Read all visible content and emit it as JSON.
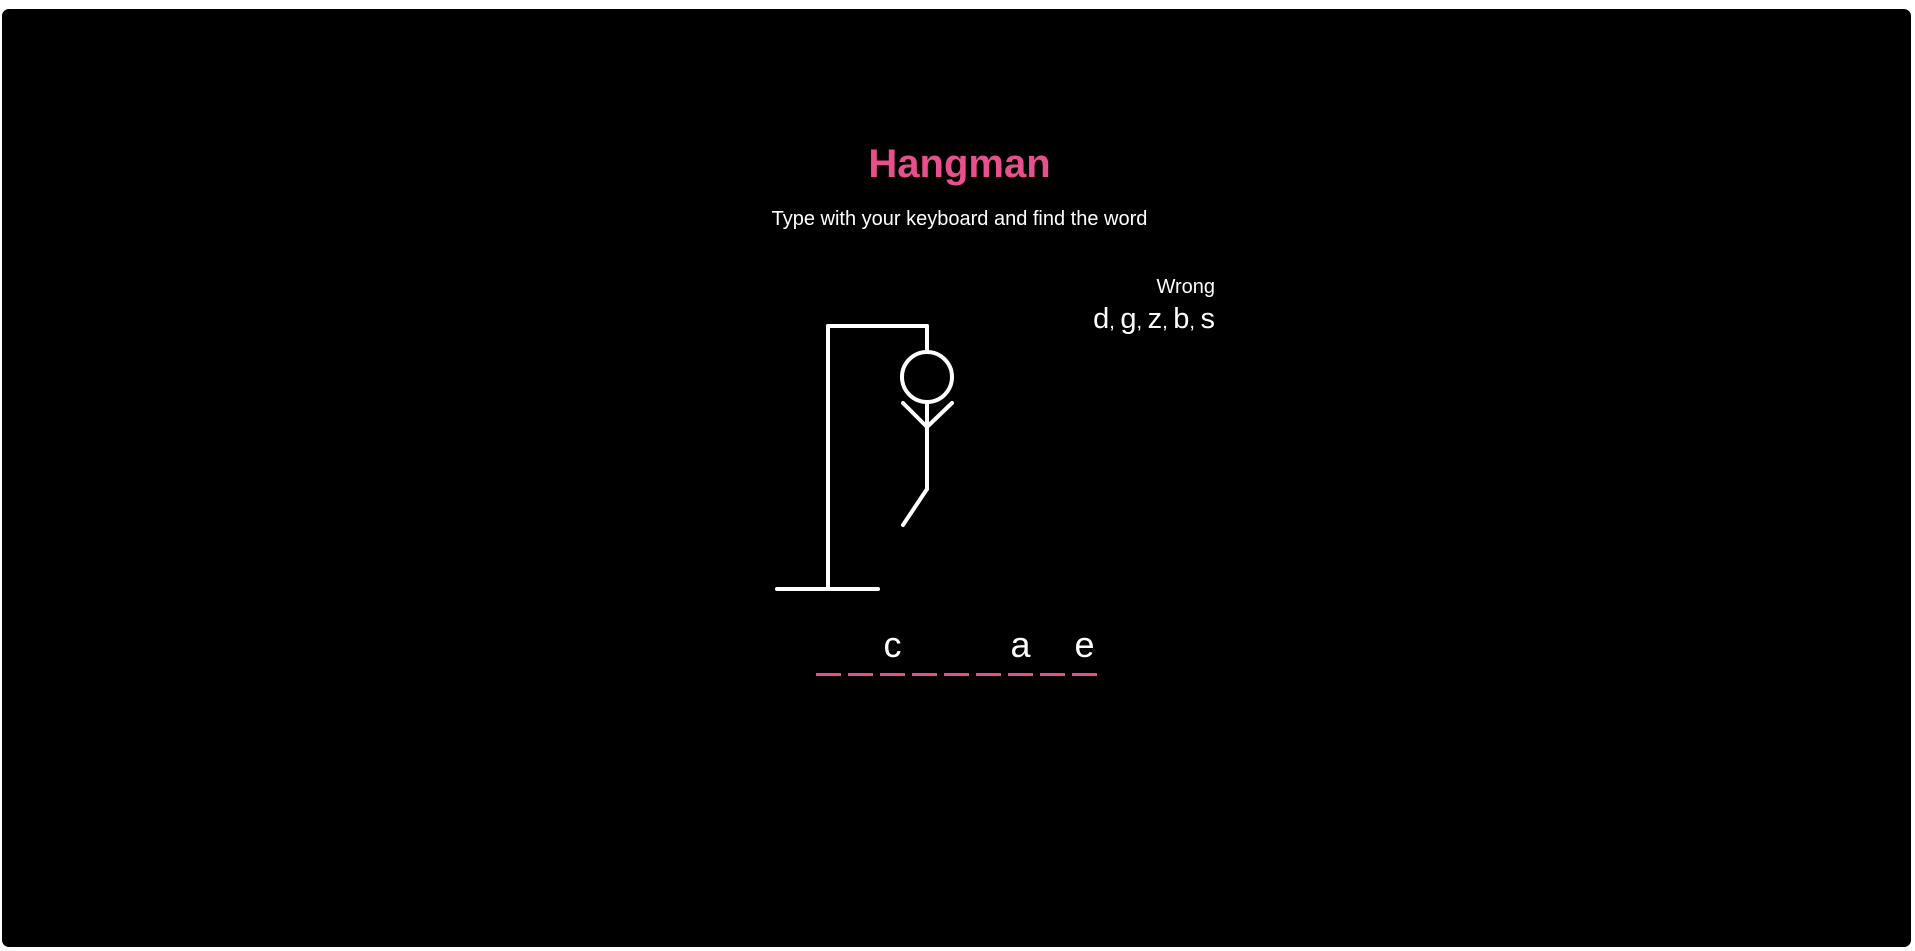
{
  "colors": {
    "background": "#000000",
    "accent": "#e84f8c",
    "foreground": "#ffffff"
  },
  "header": {
    "title": "Hangman",
    "subtitle": "Type with your keyboard and find the word"
  },
  "wrong": {
    "title": "Wrong",
    "letters": [
      "d",
      "g",
      "z",
      "b",
      "s"
    ]
  },
  "word": {
    "letters": [
      "",
      "",
      "c",
      "",
      "",
      "",
      "a",
      "",
      "e"
    ]
  },
  "figure": {
    "icon": "hangman-figure",
    "parts_shown": [
      "head",
      "body",
      "left-arm",
      "right-arm",
      "left-leg"
    ],
    "wrong_count": 5
  }
}
